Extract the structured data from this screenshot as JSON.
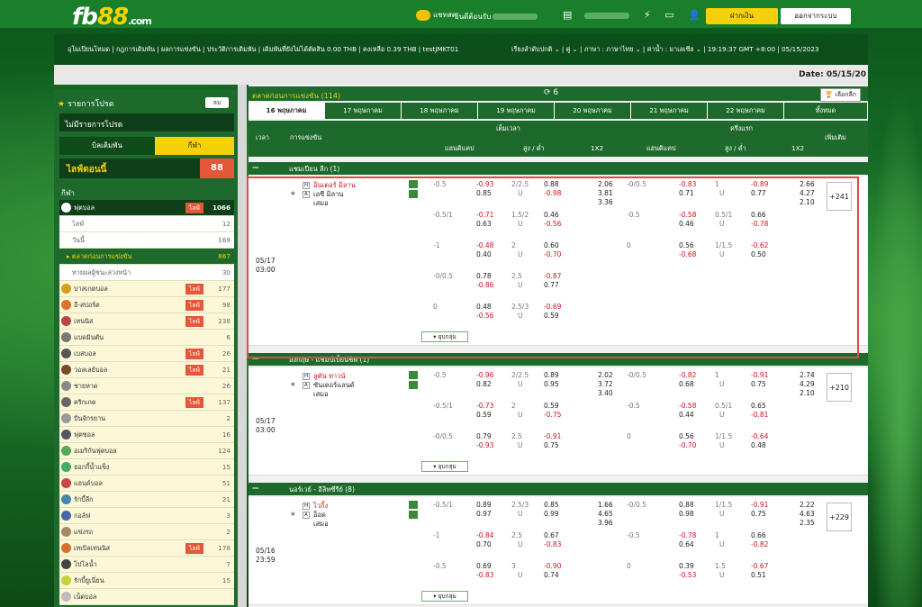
{
  "brand": {
    "logo_main": "fb",
    "logo_accent": "88",
    "logo_suffix": ".com"
  },
  "top": {
    "chat": "แชทสด",
    "welcome": "ยินดีต้อนรับ",
    "deposit": "ฝากเงิน",
    "logout": "ออกจากระบบ"
  },
  "nav": {
    "left": "อุโมเปียนโหมด | กฎการเดิมพัน | ผลการแข่งขัน | ประวัติการเดิมพัน | เดิมพันที่ยังไม่ได้ตัดสิน 0.00 THB | คงเหลือ 0.39 THB | testJMKT01",
    "right": "เรียงลำดับปกติ ⌄ | คู่ ⌄ | ภาษา : ภาษาไทย ⌄ | ค่าน้ำ : มาเลเซีย ⌄ | 19:19:37 GMT +8:00 | 05/15/2023"
  },
  "date_label": "Date: 05/15/20",
  "sidebar": {
    "fav_title": "รายการโปรด",
    "close": "ลบ",
    "no_fav": "ไม่มีรายการโปรด",
    "tab1": "บิลเดิมพัน",
    "tab2": "กีฬา",
    "live_label": "ไลฟ์ตอนนี้",
    "live_count": "88",
    "sport_label": "กีฬา",
    "items": [
      {
        "name": "ฟุตบอล",
        "live": "ไลฟ์",
        "count": "1066",
        "style": "dark",
        "icon": "soccer-icon"
      },
      {
        "name": "ไลฟ์",
        "count": "12",
        "style": "sub"
      },
      {
        "name": "วันนี้",
        "count": "169",
        "style": "sub"
      },
      {
        "name": "▸ ตลาดก่อนการแข่งขัน",
        "count": "867",
        "style": "sel"
      },
      {
        "name": "ทายผลผู้ชนะล่วงหน้า",
        "count": "30",
        "style": "sub"
      },
      {
        "name": "บาสเกตบอล",
        "live": "ไลฟ์",
        "count": "177",
        "icon": "basketball-icon"
      },
      {
        "name": "อี-สปอร์ต",
        "live": "ไลฟ์",
        "count": "98",
        "icon": "gamepad-icon"
      },
      {
        "name": "เทนนิส",
        "live": "ไลฟ์",
        "count": "238",
        "icon": "tennis-icon"
      },
      {
        "name": "แบดมินตัน",
        "count": "6",
        "icon": "badminton-icon"
      },
      {
        "name": "เบสบอล",
        "live": "ไลฟ์",
        "count": "26",
        "icon": "baseball-icon"
      },
      {
        "name": "วอลเลย์บอล",
        "live": "ไลฟ์",
        "count": "21",
        "icon": "volleyball-icon"
      },
      {
        "name": "ชายหาด",
        "count": "26",
        "icon": "beach-icon"
      },
      {
        "name": "คริกเกต",
        "live": "ไลฟ์",
        "count": "137",
        "icon": "cricket-icon"
      },
      {
        "name": "ปั่นจักรยาน",
        "count": "2",
        "icon": "cycling-icon"
      },
      {
        "name": "ฟุตซอล",
        "count": "16",
        "icon": "futsal-icon"
      },
      {
        "name": "อเมริกันฟุตบอล",
        "count": "124",
        "icon": "football-icon"
      },
      {
        "name": "ฮอกกี้น้ำแข็ง",
        "count": "15",
        "icon": "hockey-icon"
      },
      {
        "name": "แฮนด์บอล",
        "count": "51",
        "icon": "handball-icon"
      },
      {
        "name": "รักบี้ลีก",
        "count": "21",
        "icon": "rugby-icon"
      },
      {
        "name": "กอล์ฟ",
        "count": "3",
        "icon": "golf-icon"
      },
      {
        "name": "แข่งรถ",
        "count": "2",
        "icon": "racing-icon"
      },
      {
        "name": "เทเบิลเทนนิส",
        "live": "ไลฟ์",
        "count": "178",
        "icon": "pingpong-icon"
      },
      {
        "name": "โปโลน้ำ",
        "count": "7",
        "icon": "waterpolo-icon"
      },
      {
        "name": "รักบี้ยูเนี่ยน",
        "count": "15",
        "icon": "rugby-union-icon"
      },
      {
        "name": "เน็ตบอล",
        "count": "",
        "icon": "netball-icon"
      }
    ]
  },
  "main": {
    "market_title": "ตลาดก่อนการแข่งขัน (114)",
    "refresh_count": "6",
    "choose": "เลือกลีก",
    "tabs": [
      "16 พฤษภาคม",
      "17 พฤษภาคม",
      "18 พฤษภาคม",
      "19 พฤษภาคม",
      "20 พฤษภาคม",
      "21 พฤษภาคม",
      "22 พฤษภาคม",
      "ทั้งหมด"
    ],
    "hdr": {
      "time": "เวลา",
      "match": "การแข่งขัน",
      "full": "เต็มเวลา",
      "half": "ครึ่งแรก",
      "more": "เพิ่มเติม",
      "hdp": "แฮนดิแคป",
      "ou": "สูง / ต่ำ",
      "x12": "1X2"
    },
    "collapse": "ยุบกลุ่ม",
    "leagues": [
      {
        "name": "แชมเปียน ลีก (1)",
        "date": "05/17",
        "time": "03:00",
        "home": "อินเตอร์ มิลาน",
        "away": "เอซี มิลาน",
        "draw": "เสมอ",
        "more": "+241",
        "lines": [
          {
            "fh": "-0.5",
            "fho1": "-0.93",
            "fho2": "0.85",
            "fou": "2/2.5",
            "fu": "U",
            "fouo1": "0.88",
            "fouo2": "-0.98",
            "x": [
              "2.06",
              "3.81",
              "3.36"
            ],
            "hh": "-0/0.5",
            "hho1": "-0.83",
            "hho2": "0.71",
            "hou": "1",
            "hu": "U",
            "houo1": "-0.89",
            "houo2": "0.77",
            "hx": [
              "2.66",
              "4.27",
              "2.10"
            ]
          },
          {
            "fh": "-0.5/1",
            "fho1": "-0.71",
            "fho2": "0.63",
            "fou": "1.5/2",
            "fu": "U",
            "fouo1": "0.46",
            "fouo2": "-0.56",
            "hh": "-0.5",
            "hho1": "-0.58",
            "hho2": "0.46",
            "hou": "0.5/1",
            "hu": "U",
            "houo1": "0.66",
            "houo2": "-0.78"
          },
          {
            "fh": "-1",
            "fho1": "-0.48",
            "fho2": "0.40",
            "fou": "2",
            "fu": "U",
            "fouo1": "0.60",
            "fouo2": "-0.70",
            "hh": "0",
            "hho1": "0.56",
            "hho2": "-0.68",
            "hou": "1/1.5",
            "hu": "U",
            "houo1": "-0.62",
            "houo2": "0.50"
          },
          {
            "fh": "-0/0.5",
            "fho1": "0.78",
            "fho2": "-0.86",
            "fou": "2.5",
            "fu": "U",
            "fouo1": "-0.87",
            "fouo2": "0.77"
          },
          {
            "fh": "0",
            "fho1": "0.48",
            "fho2": "-0.56",
            "fou": "2.5/3",
            "fu": "U",
            "fouo1": "-0.69",
            "fouo2": "0.59"
          }
        ]
      },
      {
        "name": "อังกฤษ - แชมป์เปี้ยนชิพ (1)",
        "date": "05/17",
        "time": "03:00",
        "home": "ลูตัน ทาวน์",
        "away": "ซันเดอร์แลนด์",
        "draw": "เสมอ",
        "more": "+210",
        "lines": [
          {
            "fh": "-0.5",
            "fho1": "-0.96",
            "fho2": "0.82",
            "fou": "2/2.5",
            "fu": "U",
            "fouo1": "0.89",
            "fouo2": "0.95",
            "x": [
              "2.02",
              "3.72",
              "3.40"
            ],
            "hh": "-0/0.5",
            "hho1": "-0.82",
            "hho2": "0.68",
            "hou": "1",
            "hu": "U",
            "houo1": "-0.91",
            "houo2": "0.75",
            "hx": [
              "2.74",
              "4.29",
              "2.10"
            ]
          },
          {
            "fh": "-0.5/1",
            "fho1": "-0.73",
            "fho2": "0.59",
            "fou": "2",
            "fu": "U",
            "fouo1": "0.59",
            "fouo2": "-0.75",
            "hh": "-0.5",
            "hho1": "-0.58",
            "hho2": "0.44",
            "hou": "0.5/1",
            "hu": "U",
            "houo1": "0.65",
            "houo2": "-0.81"
          },
          {
            "fh": "-0/0.5",
            "fho1": "0.79",
            "fho2": "-0.93",
            "fou": "2.5",
            "fu": "U",
            "fouo1": "-0.91",
            "fouo2": "0.75",
            "hh": "0",
            "hho1": "0.56",
            "hho2": "-0.70",
            "hou": "1/1.5",
            "hu": "U",
            "houo1": "-0.64",
            "houo2": "0.48"
          }
        ]
      },
      {
        "name": "นอร์เวย์ - อีลิทซีรีย์ (8)",
        "date": "05/16",
        "time": "23:59",
        "home": "ไวกิ้ง",
        "away": "อ็อด",
        "draw": "เสมอ",
        "more": "+229",
        "lines": [
          {
            "fh": "-0.5/1",
            "fho1": "0.89",
            "fho2": "0.97",
            "fou": "2.5/3",
            "fu": "U",
            "fouo1": "0.85",
            "fouo2": "0.99",
            "x": [
              "1.66",
              "4.65",
              "3.96"
            ],
            "hh": "-0/0.5",
            "hho1": "0.88",
            "hho2": "0.98",
            "hou": "1/1.5",
            "hu": "U",
            "houo1": "-0.91",
            "houo2": "0.75",
            "hx": [
              "2.22",
              "4.63",
              "2.35"
            ]
          },
          {
            "fh": "-1",
            "fho1": "-0.84",
            "fho2": "0.70",
            "fou": "2.5",
            "fu": "U",
            "fouo1": "0.67",
            "fouo2": "-0.83",
            "hh": "-0.5",
            "hho1": "-0.78",
            "hho2": "0.64",
            "hou": "1",
            "hu": "U",
            "houo1": "0.66",
            "houo2": "-0.82"
          },
          {
            "fh": "-0.5",
            "fho1": "0.69",
            "fho2": "-0.83",
            "fou": "3",
            "fu": "U",
            "fouo1": "-0.90",
            "fouo2": "0.74",
            "hh": "0",
            "hho1": "0.39",
            "hho2": "-0.53",
            "hou": "1.5",
            "hu": "U",
            "houo1": "-0.67",
            "houo2": "0.51"
          }
        ]
      }
    ]
  }
}
